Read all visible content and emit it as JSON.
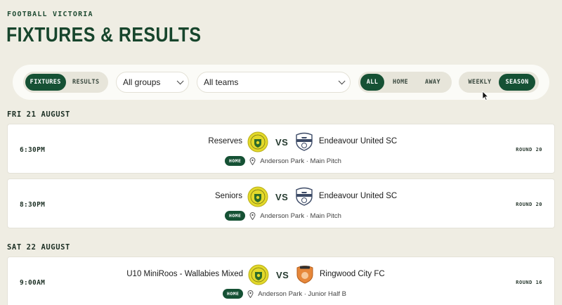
{
  "header": {
    "eyebrow": "FOOTBALL VICTORIA",
    "title": "FIXTURES & RESULTS"
  },
  "filters": {
    "view_tabs": [
      {
        "label": "FIXTURES",
        "active": true
      },
      {
        "label": "RESULTS",
        "active": false
      }
    ],
    "groups_select": "All groups",
    "teams_select": "All teams",
    "venue_tabs": [
      {
        "label": "ALL",
        "active": true
      },
      {
        "label": "HOME",
        "active": false
      },
      {
        "label": "AWAY",
        "active": false
      }
    ],
    "period_tabs": [
      {
        "label": "WEEKLY",
        "active": false
      },
      {
        "label": "SEASON",
        "active": true
      }
    ]
  },
  "days": [
    {
      "date": "FRI 21 AUGUST",
      "fixtures": [
        {
          "time": "6:30PM",
          "home_team": "Reserves",
          "home_crest": "yellow-club-crest-icon",
          "vs": "VS",
          "away_team": "Endeavour United SC",
          "away_crest": "endeavour-united-crest-icon",
          "badge": "HOME",
          "venue": "Anderson Park · Main Pitch",
          "round": "ROUND 20"
        },
        {
          "time": "8:30PM",
          "home_team": "Seniors",
          "home_crest": "yellow-club-crest-icon",
          "vs": "VS",
          "away_team": "Endeavour United SC",
          "away_crest": "endeavour-united-crest-icon",
          "badge": "HOME",
          "venue": "Anderson Park · Main Pitch",
          "round": "ROUND 20"
        }
      ]
    },
    {
      "date": "SAT 22 AUGUST",
      "fixtures": [
        {
          "time": "9:00AM",
          "home_team": "U10 MiniRoos - Wallabies Mixed",
          "home_crest": "yellow-club-crest-icon",
          "vs": "VS",
          "away_team": "Ringwood City FC",
          "away_crest": "ringwood-city-crest-icon",
          "badge": "HOME",
          "venue": "Anderson Park · Junior Half B",
          "round": "ROUND 16"
        }
      ]
    }
  ],
  "colors": {
    "primary": "#155134",
    "background": "#efede3",
    "crest_yellow": "#e3d92a",
    "ringwood_orange": "#e6873a"
  }
}
